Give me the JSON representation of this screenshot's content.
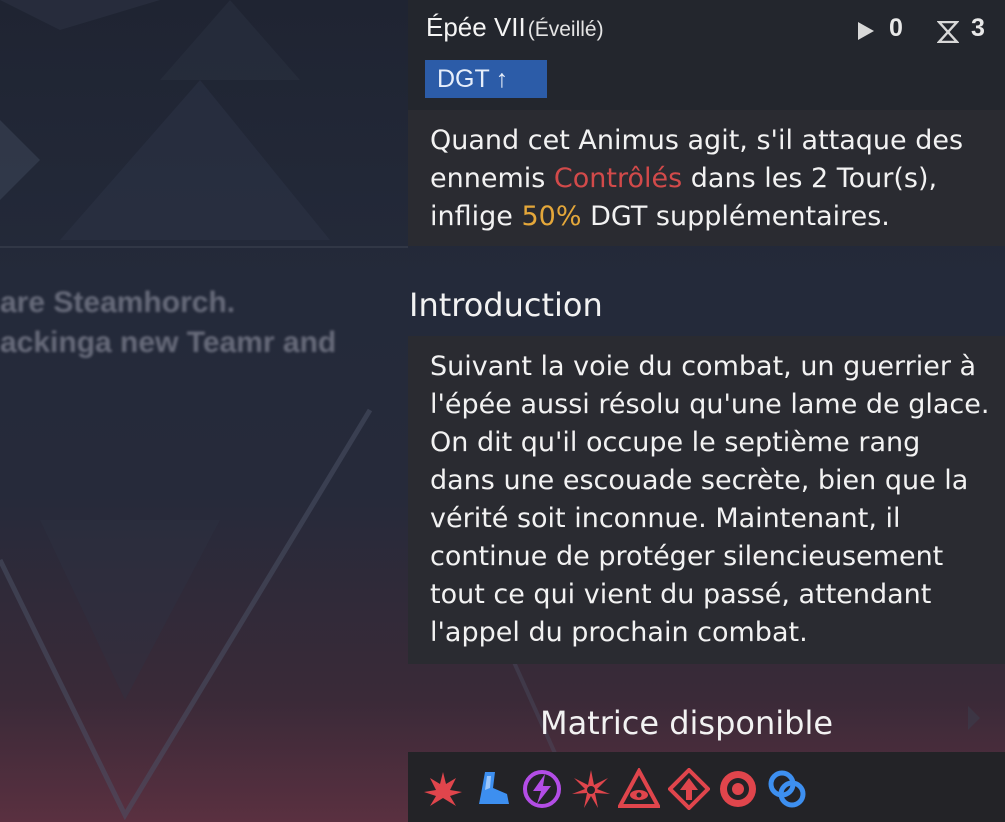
{
  "card": {
    "name": "Épée VII",
    "state": "(Éveillé)",
    "tag": "DGT",
    "tag_arrow": "↑",
    "play_value": "0",
    "hourglass_value": "3",
    "effect": {
      "p1": "Quand cet Animus agit, s'il attaque des ennemis ",
      "highlight1": "Contrôlés",
      "p2": " dans les 2 Tour(s), inflige ",
      "highlight2": "50%",
      "p3": " DGT supplémentaires."
    }
  },
  "introduction": {
    "heading": "Introduction",
    "text": "Suivant la voie du combat, un guerrier à l'épée aussi résolu qu'une lame de glace. On dit qu'il occupe le septième rang dans une escouade secrète, bien que la vérité soit inconnue. Maintenant, il continue de protéger silencieusement tout ce qui vient du passé, attendant l'appel du prochain combat."
  },
  "matrix": {
    "title": "Matrice disponible",
    "icons": [
      {
        "name": "flame-burst-icon",
        "color": "#e0454c"
      },
      {
        "name": "boot-icon",
        "color": "#3d8ff0"
      },
      {
        "name": "lightning-orb-icon",
        "color": "#b34de6"
      },
      {
        "name": "spiked-star-icon",
        "color": "#e0454c"
      },
      {
        "name": "eye-triangle-icon",
        "color": "#e0454c"
      },
      {
        "name": "diamond-arrow-icon",
        "color": "#e0454c"
      },
      {
        "name": "ring-target-icon",
        "color": "#e0454c"
      },
      {
        "name": "link-chain-icon",
        "color": "#3d8ff0"
      }
    ]
  },
  "background": {
    "blurred_line1": "are Steamhorch.",
    "blurred_line2": "ackinga new Teamr and"
  }
}
